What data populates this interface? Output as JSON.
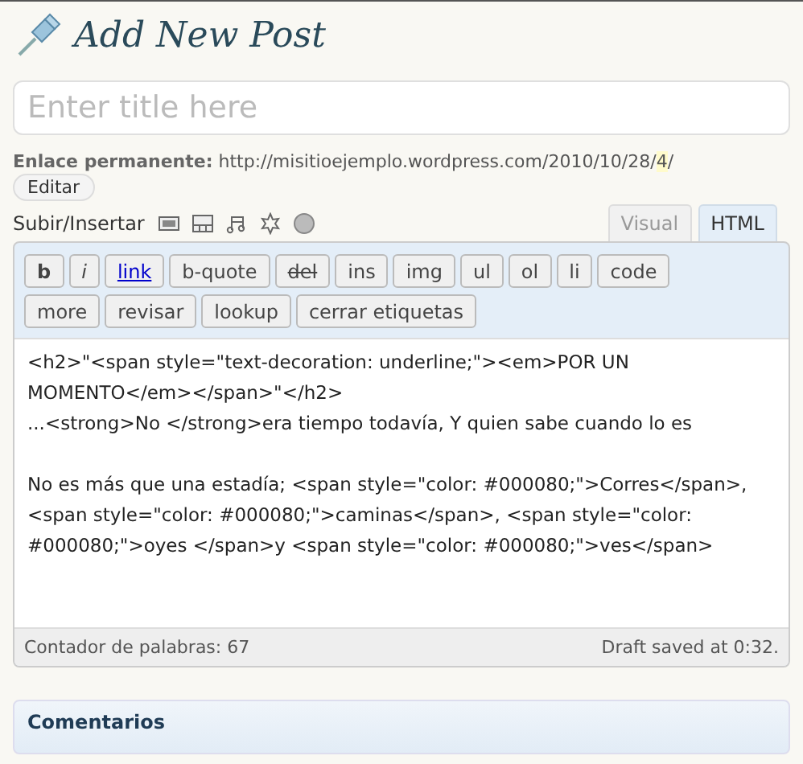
{
  "header": {
    "title": "Add New Post"
  },
  "title_field": {
    "placeholder": "Enter title here"
  },
  "permalink": {
    "label": "Enlace permanente:",
    "url_start": "http://misitioejemplo.wordpress.com/2010/10/28/",
    "url_slug": "4",
    "url_end": "/",
    "edit_button": "Editar"
  },
  "media": {
    "label": "Subir/Insertar"
  },
  "editor_tabs": [
    {
      "label": "Visual",
      "selected": false
    },
    {
      "label": "HTML",
      "selected": true
    }
  ],
  "quicktags": [
    {
      "label": "b",
      "kind": "bold"
    },
    {
      "label": "i",
      "kind": "italic"
    },
    {
      "label": "link",
      "kind": "link"
    },
    {
      "label": "b-quote",
      "kind": "plain"
    },
    {
      "label": "del",
      "kind": "strike"
    },
    {
      "label": "ins",
      "kind": "plain"
    },
    {
      "label": "img",
      "kind": "plain"
    },
    {
      "label": "ul",
      "kind": "plain"
    },
    {
      "label": "ol",
      "kind": "plain"
    },
    {
      "label": "li",
      "kind": "plain"
    },
    {
      "label": "code",
      "kind": "plain"
    },
    {
      "label": "more",
      "kind": "plain"
    },
    {
      "label": "revisar",
      "kind": "plain"
    },
    {
      "label": "lookup",
      "kind": "plain"
    },
    {
      "label": "cerrar etiquetas",
      "kind": "plain"
    }
  ],
  "content": "<h2>\"<span style=\"text-decoration: underline;\"><em>POR UN MOMENTO</em></span>\"</h2>\n...<strong>No </strong>era tiempo todavía, Y quien sabe cuando lo es\n\nNo es más que una estadía; <span style=\"color: #000080;\">Corres</span>, <span style=\"color: #000080;\">caminas</span>, <span style=\"color: #000080;\">oyes </span>y <span style=\"color: #000080;\">ves</span>",
  "status": {
    "word_count": "Contador de palabras: 67",
    "draft": "Draft saved at 0:32."
  },
  "comments_panel": {
    "title": "Comentarios"
  }
}
